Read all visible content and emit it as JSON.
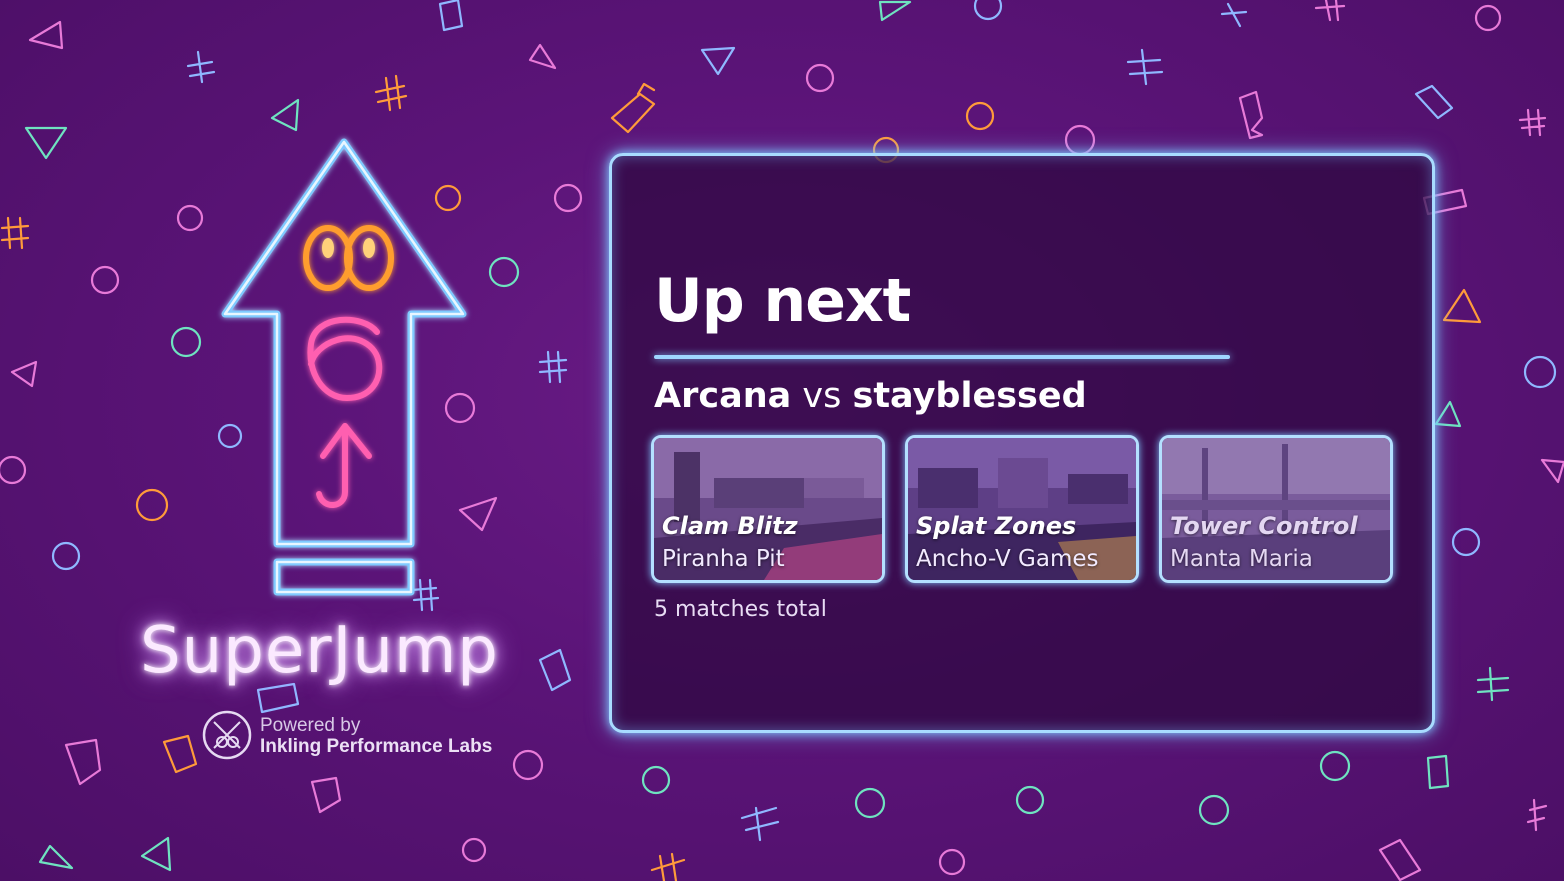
{
  "colors": {
    "background": "#5b1478",
    "neon_blue": "#a8dcff",
    "neon_orange": "#ff9d2e",
    "neon_pink": "#ff5fb0"
  },
  "branding": {
    "name": "SuperJump",
    "powered_by": "Powered by",
    "organization": "Inkling Performance Labs",
    "logo_icon": "neon-up-arrow-icon",
    "emblem_icon": "inkling-labs-emblem-icon"
  },
  "panel": {
    "title": "Up next",
    "matchup": {
      "team_a": "Arcana",
      "vs": "vs",
      "team_b": "stayblessed"
    },
    "matches": [
      {
        "mode": "Clam Blitz",
        "map": "Piranha Pit"
      },
      {
        "mode": "Splat Zones",
        "map": "Ancho-V Games"
      },
      {
        "mode": "Tower Control",
        "map": "Manta Maria"
      }
    ],
    "total": "5 matches total"
  }
}
